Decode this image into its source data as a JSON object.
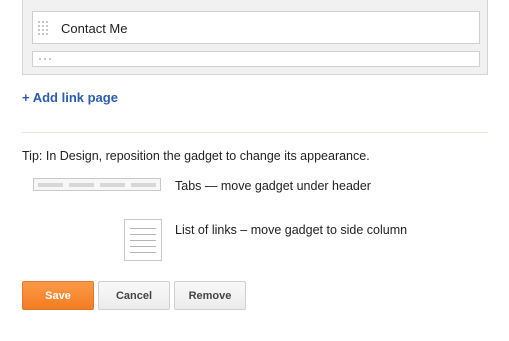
{
  "links": {
    "items": [
      {
        "label": "Contact Me"
      }
    ],
    "add_link_label": "+ Add link page"
  },
  "tip": {
    "text": "Tip: In Design, reposition the gadget to change its appearance.",
    "options": [
      {
        "icon": "tabs-layout-icon",
        "desc": "Tabs — move gadget under header"
      },
      {
        "icon": "list-layout-icon",
        "desc": "List of links – move gadget to side column"
      }
    ]
  },
  "buttons": {
    "save": "Save",
    "cancel": "Cancel",
    "remove": "Remove"
  },
  "colors": {
    "accent_link": "#2a5db0",
    "save_button": "#f47c22"
  }
}
